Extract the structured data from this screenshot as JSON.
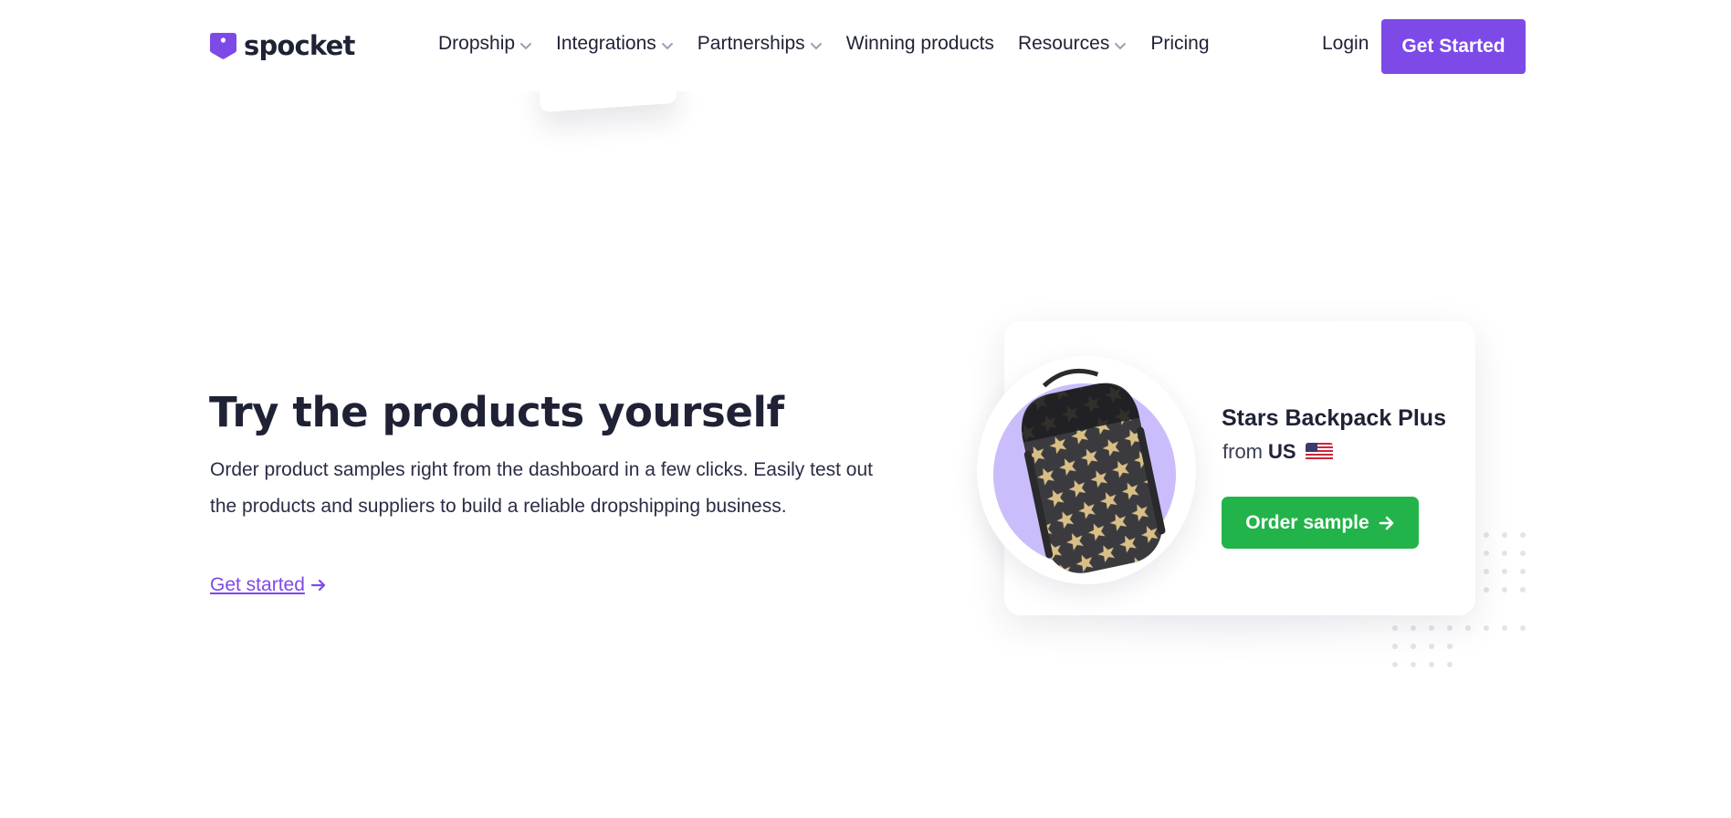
{
  "header": {
    "logo_text": "spocket",
    "nav": [
      {
        "label": "Dropship",
        "has_dropdown": true
      },
      {
        "label": "Integrations",
        "has_dropdown": true
      },
      {
        "label": "Partnerships",
        "has_dropdown": true
      },
      {
        "label": "Winning products",
        "has_dropdown": false
      },
      {
        "label": "Resources",
        "has_dropdown": true
      },
      {
        "label": "Pricing",
        "has_dropdown": false
      }
    ],
    "login_label": "Login",
    "cta_label": "Get Started"
  },
  "feature": {
    "headline": "Try the products yourself",
    "description": "Order product samples right from the dashboard in a few clicks. Easily test out the products and suppliers to build a reliable dropshipping business.",
    "link_label": "Get started"
  },
  "product_card": {
    "name": "Stars Backpack Plus",
    "origin_prefix": "from",
    "origin_country": "US",
    "button_label": "Order sample"
  },
  "colors": {
    "brand_purple": "#7d4ae8",
    "text_dark": "#1f2235",
    "order_green": "#22b44a",
    "blob_lavender": "#cbbdfb"
  },
  "icons": [
    "spocket-logo-icon",
    "chevron-down-icon",
    "arrow-right-icon",
    "us-flag-icon",
    "backpack-image"
  ]
}
